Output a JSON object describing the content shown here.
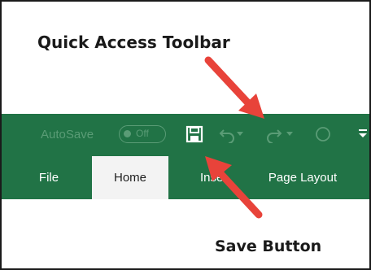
{
  "callouts": {
    "quick_access": "Quick Access Toolbar",
    "save_button": "Save Button"
  },
  "qat": {
    "autosave_label": "AutoSave",
    "autosave_state": "Off",
    "icons": [
      "save-icon",
      "undo-icon",
      "redo-icon",
      "touch-mode-icon",
      "customize-qat-icon"
    ]
  },
  "tabs": [
    {
      "label": "File"
    },
    {
      "label": "Home"
    },
    {
      "label": "Inse"
    },
    {
      "label": "Page Layout"
    }
  ],
  "colors": {
    "ribbon": "#217346",
    "active_tab": "#f3f3f3",
    "arrow": "#e8433a"
  }
}
